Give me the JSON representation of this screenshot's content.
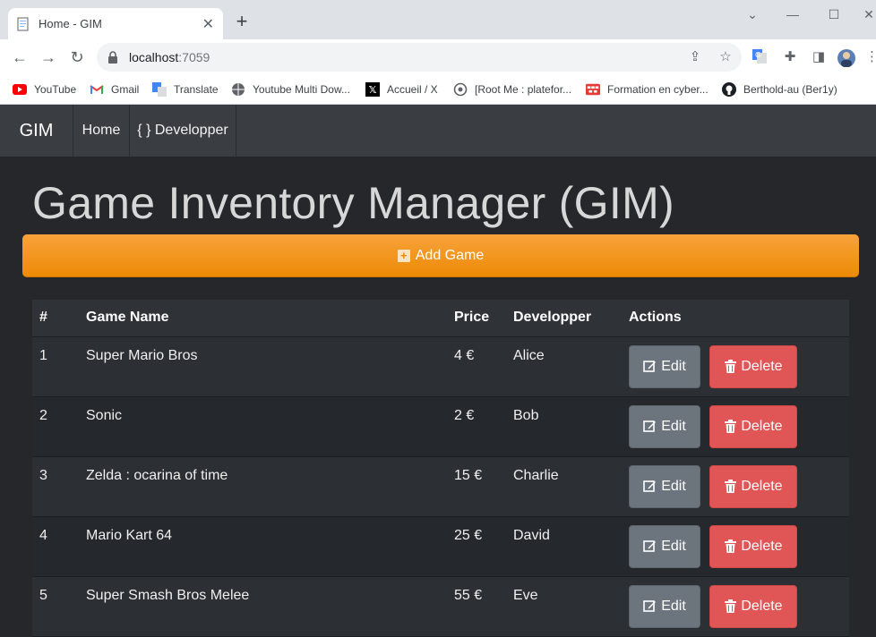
{
  "browser": {
    "tab_title": "Home - GIM",
    "url_host": "localhost",
    "url_port": ":7059",
    "bookmarks": [
      {
        "label": "YouTube",
        "icon": "youtube-icon"
      },
      {
        "label": "Gmail",
        "icon": "gmail-icon"
      },
      {
        "label": "Translate",
        "icon": "translate-icon"
      },
      {
        "label": "Youtube Multi Dow...",
        "icon": "globe-icon"
      },
      {
        "label": "Accueil / X",
        "icon": "x-icon"
      },
      {
        "label": "[Root Me : platefor...",
        "icon": "rootme-icon"
      },
      {
        "label": "Formation en cyber...",
        "icon": "cyber-icon"
      },
      {
        "label": "Berthold-au (Ber1y)",
        "icon": "github-icon"
      }
    ]
  },
  "nav": {
    "brand": "GIM",
    "links": [
      {
        "label": "Home"
      },
      {
        "label": "{ } Developper"
      }
    ]
  },
  "main": {
    "heading": "Game Inventory Manager (GIM)",
    "add_button": "Add Game"
  },
  "table": {
    "headers": [
      "#",
      "Game Name",
      "Price",
      "Developper",
      "Actions"
    ],
    "rows": [
      {
        "id": "1",
        "name": "Super Mario Bros",
        "price": "4 €",
        "dev": "Alice",
        "edit": "Edit",
        "delete": "Delete"
      },
      {
        "id": "2",
        "name": "Sonic",
        "price": "2 €",
        "dev": "Bob",
        "edit": "Edit",
        "delete": "Delete"
      },
      {
        "id": "3",
        "name": "Zelda : ocarina of time",
        "price": "15 €",
        "dev": "Charlie",
        "edit": "Edit",
        "delete": "Delete"
      },
      {
        "id": "4",
        "name": "Mario Kart 64",
        "price": "25 €",
        "dev": "David",
        "edit": "Edit",
        "delete": "Delete"
      },
      {
        "id": "5",
        "name": "Super Smash Bros Melee",
        "price": "55 €",
        "dev": "Eve",
        "edit": "Edit",
        "delete": "Delete"
      }
    ]
  },
  "colors": {
    "page_bg": "#25272b",
    "navbar_bg": "#3a3e43",
    "add_button": "#f0900f",
    "edit_button": "#6c757d",
    "delete_button": "#e05656"
  }
}
